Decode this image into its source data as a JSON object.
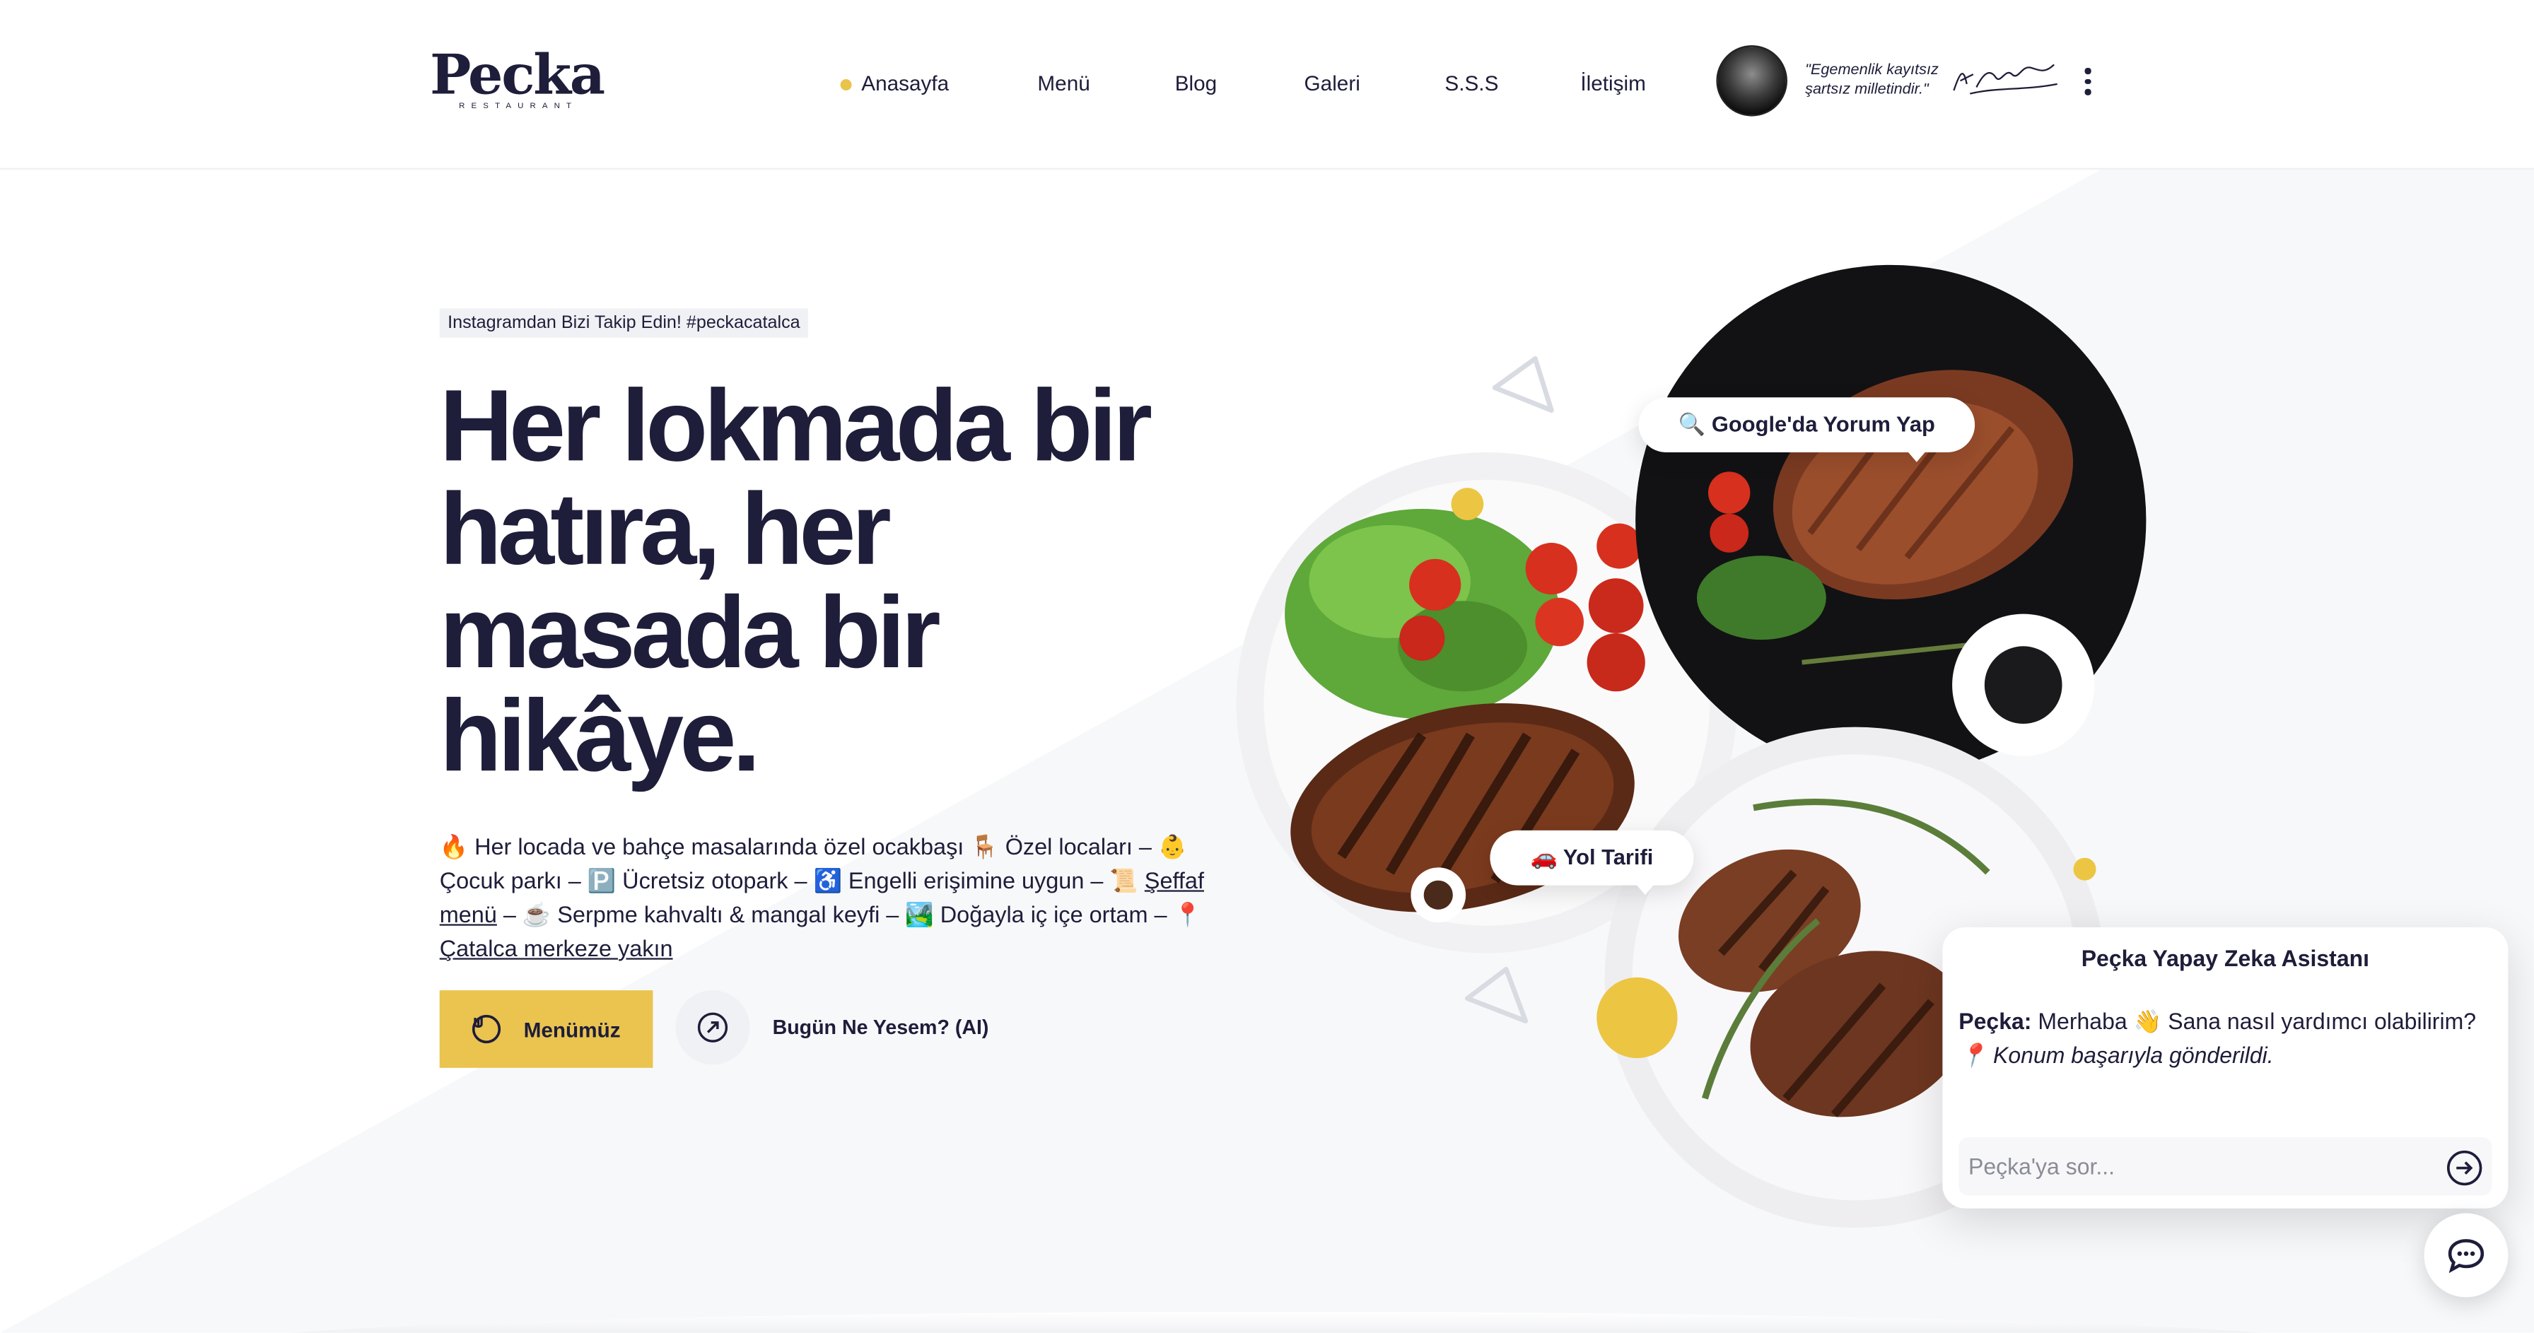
{
  "brand": {
    "name": "Pecka",
    "sub": "RESTAURANT"
  },
  "nav": {
    "items": [
      {
        "label": "Anasayfa",
        "active": true
      },
      {
        "label": "Menü"
      },
      {
        "label": "Blog"
      },
      {
        "label": "Galeri"
      },
      {
        "label": "S.S.S"
      },
      {
        "label": "İletişim"
      }
    ],
    "quote_line1": "\"Egemenlik kayıtsız",
    "quote_line2": "şartsız milletindir.\""
  },
  "hero": {
    "tag": "Instagramdan Bizi Takip Edin! #peckacatalca",
    "headline": [
      "Her lokmada bir",
      "hatıra, her",
      "masada bir",
      "hikâye."
    ],
    "desc": {
      "part1": "🔥 Her locada ve bahçe masalarında özel ocakbaşı 🪑 Özel locaları – 👶 Çocuk parkı – 🅿️ Ücretsiz otopark – ♿ Engelli erişimine uygun – 📜 ",
      "link1": "Şeffaf menü",
      "part2": " – ☕ Serpme kahvaltı & mangal keyfi – 🏞️ Doğayla iç içe ortam – 📍 ",
      "link2": "Çatalca merkeze yakın"
    },
    "menu_button": "Menümüz",
    "ai_button": "Bugün Ne Yesem? (AI)"
  },
  "bubbles": {
    "google": "🔍 Google'da Yorum Yap",
    "directions": "🚗 Yol Tarifi"
  },
  "chat": {
    "title": "Peçka Yapay Zeka Asistanı",
    "sender": "Peçka:",
    "message": " Merhaba 👋 Sana nasıl yardımcı olabilirim?",
    "status": "📍 Konum başarıyla gönderildi.",
    "placeholder": "Peçka'ya sor..."
  },
  "colors": {
    "accent": "#eac44f",
    "ink": "#1e1d3a",
    "soft": "#f0f1f4"
  },
  "icons": [
    "chef-hat-icon",
    "compass-icon",
    "send-arrow-icon",
    "chat-bubble-icon",
    "kebab-menu-icon"
  ]
}
